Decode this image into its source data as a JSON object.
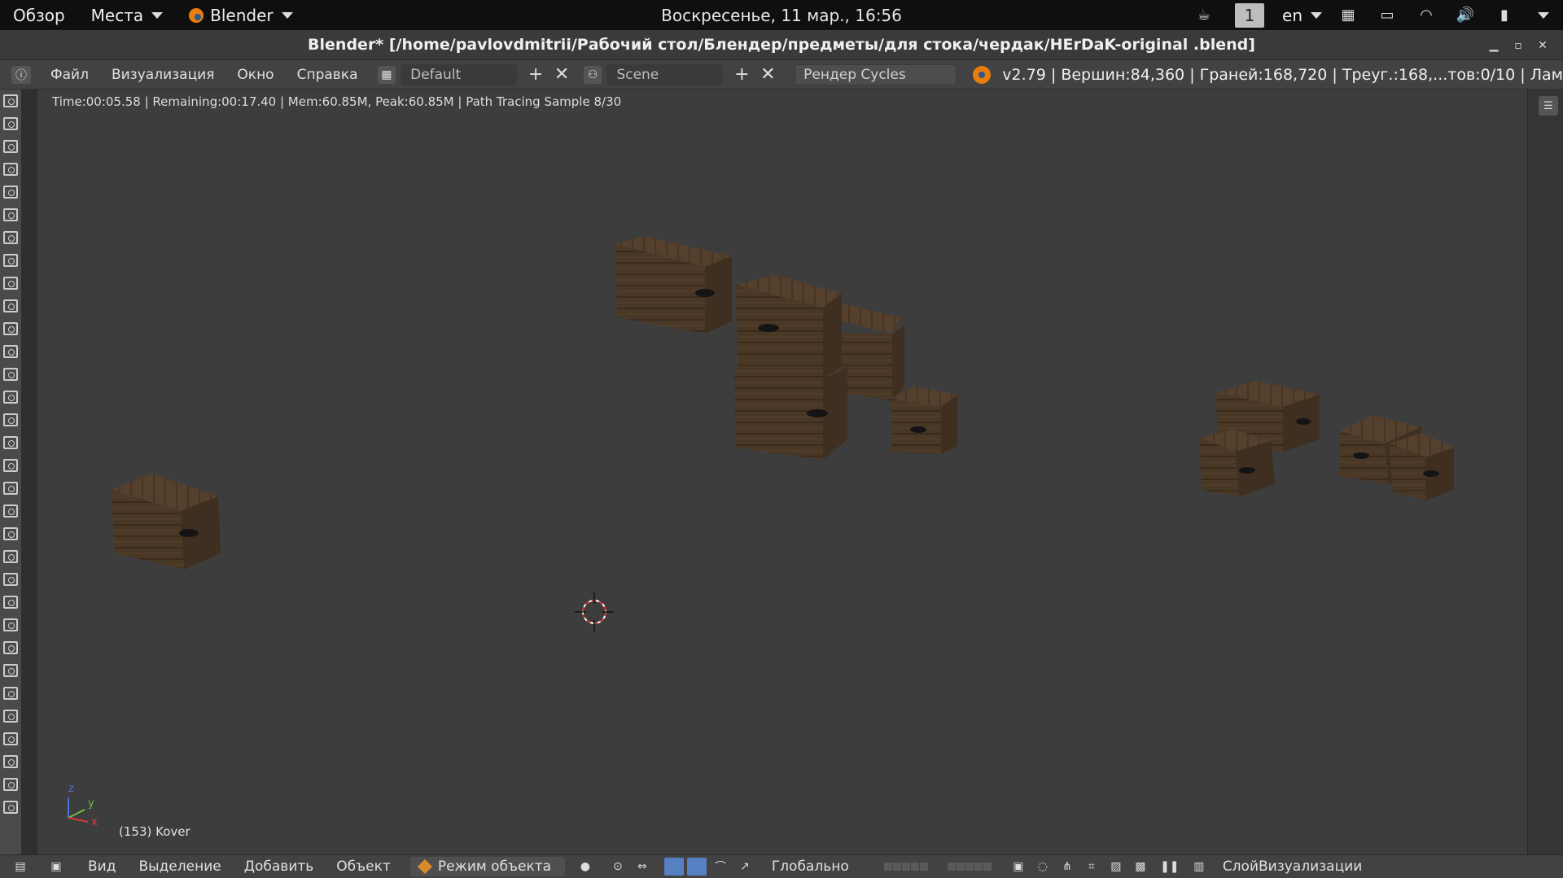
{
  "system_bar": {
    "activities": "Обзор",
    "places": "Места",
    "app_menu": "Blender",
    "clock": "Воскресенье, 11 мар., 16:56",
    "workspace": "1",
    "keyboard_layout": "en"
  },
  "window": {
    "title": "Blender* [/home/pavlovdmitrii/Рабочий стол/Блендер/предметы/для стока/чердак/HErDaK-original .blend]"
  },
  "info_header": {
    "menu": [
      "Файл",
      "Визуализация",
      "Окно",
      "Справка"
    ],
    "screen_layout": "Default",
    "scene": "Scene",
    "render_engine": "Рендер Cycles",
    "stats": "v2.79 | Вершин:84,360 | Граней:168,720 | Треуг.:168,...тов:0/10 | Лам"
  },
  "viewport": {
    "render_info": "Time:00:05.58 | Remaining:00:17.40 | Mem:60.85M, Peak:60.85M | Path Tracing Sample 8/30",
    "active_object": "(153) Kover",
    "axis": {
      "x": "x",
      "y": "y",
      "z": "z"
    }
  },
  "view3d_header": {
    "menu": [
      "Вид",
      "Выделение",
      "Добавить",
      "Объект"
    ],
    "mode": "Режим объекта",
    "orientation": "Глобально",
    "render_layer": "СлойВизуализации"
  },
  "colors": {
    "viewport_bg": "#3d3d3d",
    "crate_wood": "#4a3826",
    "accent_blue": "#5680c2",
    "blender_orange": "#e87d0d"
  }
}
